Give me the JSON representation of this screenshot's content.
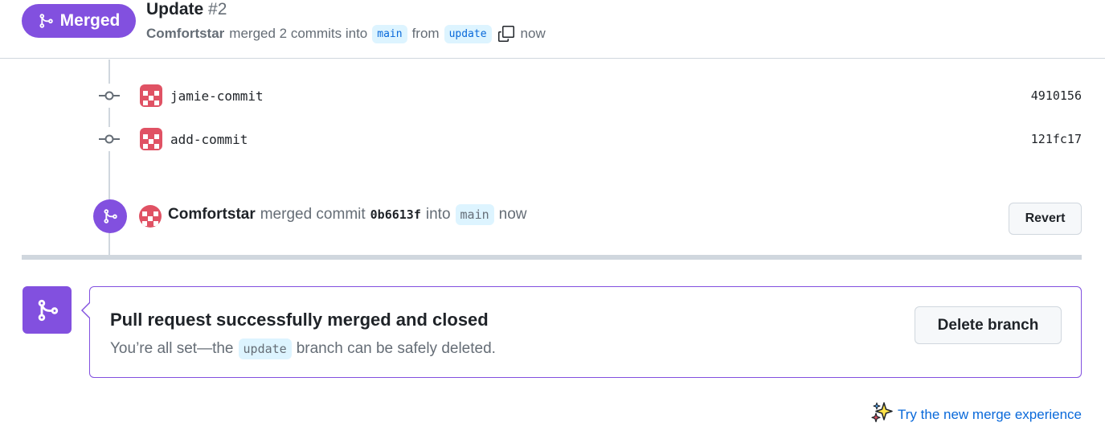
{
  "header": {
    "state_label": "Merged",
    "title": "Update",
    "number": "#2",
    "author": "Comfortstar",
    "merged_text": "merged 2 commits into",
    "base_branch": "main",
    "from_text": "from",
    "head_branch": "update",
    "time": "now"
  },
  "commits": [
    {
      "message": "jamie-commit",
      "sha": "4910156"
    },
    {
      "message": "add-commit",
      "sha": "121fc17"
    }
  ],
  "merge_event": {
    "author": "Comfortstar",
    "text_merged": "merged commit",
    "sha": "0b6613f",
    "text_into": "into",
    "branch": "main",
    "time": "now",
    "revert_label": "Revert"
  },
  "merged_box": {
    "title": "Pull request successfully merged and closed",
    "desc_prefix": "You’re all set—the",
    "branch": "update",
    "desc_suffix": "branch can be safely deleted.",
    "delete_label": "Delete branch"
  },
  "footer": {
    "try_label": "Try the new merge experience"
  },
  "colors": {
    "merged_purple": "#8250df",
    "link_blue": "#0969da",
    "branch_bg": "#ddf4ff",
    "avatar_red": "#e05264"
  }
}
